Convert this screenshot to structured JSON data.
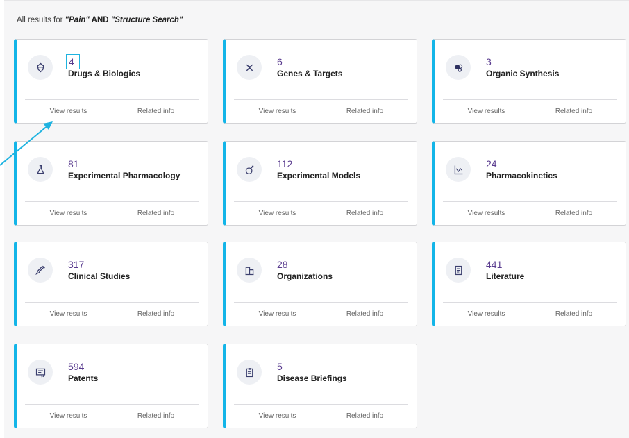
{
  "header": {
    "prefix": "All results for ",
    "term1": "\"Pain\"",
    "connector": " AND ",
    "term2": "\"Structure Search\""
  },
  "cards": [
    {
      "count": "4",
      "title": "Drugs & Biologics",
      "icon": "drug-icon",
      "view": "View results",
      "related": "Related info"
    },
    {
      "count": "6",
      "title": "Genes & Targets",
      "icon": "gene-icon",
      "view": "View results",
      "related": "Related info"
    },
    {
      "count": "3",
      "title": "Organic Synthesis",
      "icon": "molecule-icon",
      "view": "View results",
      "related": "Related info"
    },
    {
      "count": "81",
      "title": "Experimental Pharmacology",
      "icon": "flask-icon",
      "view": "View results",
      "related": "Related info"
    },
    {
      "count": "112",
      "title": "Experimental Models",
      "icon": "mouse-icon",
      "view": "View results",
      "related": "Related info"
    },
    {
      "count": "24",
      "title": "Pharmacokinetics",
      "icon": "chart-icon",
      "view": "View results",
      "related": "Related info"
    },
    {
      "count": "317",
      "title": "Clinical Studies",
      "icon": "syringe-icon",
      "view": "View results",
      "related": "Related info"
    },
    {
      "count": "28",
      "title": "Organizations",
      "icon": "building-icon",
      "view": "View results",
      "related": "Related info"
    },
    {
      "count": "441",
      "title": "Literature",
      "icon": "document-icon",
      "view": "View results",
      "related": "Related info"
    },
    {
      "count": "594",
      "title": "Patents",
      "icon": "certificate-icon",
      "view": "View results",
      "related": "Related info"
    },
    {
      "count": "5",
      "title": "Disease Briefings",
      "icon": "clipboard-icon",
      "view": "View results",
      "related": "Related info"
    }
  ],
  "colors": {
    "accent": "#13b5e8",
    "count": "#5a3c8f",
    "highlight": "#1fb3e0"
  }
}
